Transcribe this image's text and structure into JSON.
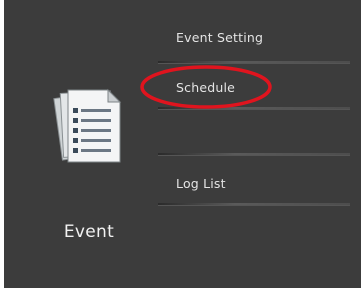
{
  "section": {
    "label": "Event",
    "icon": "document-stack-icon"
  },
  "menu": {
    "items": [
      {
        "label": "Event Setting"
      },
      {
        "label": "Schedule"
      },
      {
        "label": ""
      },
      {
        "label": "Log List"
      }
    ]
  },
  "annotation": {
    "color": "#e0141e",
    "target": "Schedule"
  },
  "colors": {
    "panel_bg": "#3c3c3c",
    "text": "#e4e4e4"
  }
}
